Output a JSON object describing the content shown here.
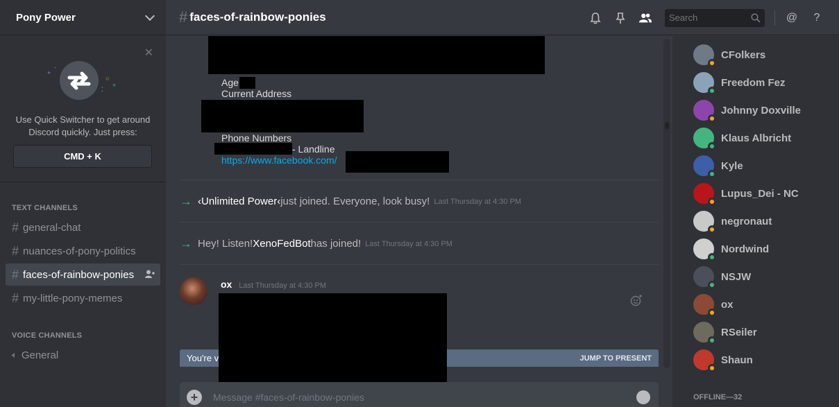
{
  "guild": {
    "name": "Pony Power"
  },
  "quick_switcher": {
    "text": "Use Quick Switcher to get around Discord quickly. Just press:",
    "shortcut": "CMD + K",
    "close": "✕"
  },
  "sidebar": {
    "text_category": "TEXT CHANNELS",
    "voice_category": "VOICE CHANNELS",
    "text_channels": [
      {
        "label": "general-chat"
      },
      {
        "label": "nuances-of-pony-politics"
      },
      {
        "label": "faces-of-rainbow-ponies"
      },
      {
        "label": "my-little-pony-memes"
      }
    ],
    "voice_channels": [
      {
        "label": "General"
      }
    ]
  },
  "header": {
    "hash": "#",
    "channel": "faces-of-rainbow-ponies",
    "search_placeholder": "Search",
    "mention": "@",
    "help": "?"
  },
  "messages": {
    "age_label": "Age",
    "current_address_label": "Current Address",
    "phone_numbers_label": "Phone Numbers",
    "landline_label": "- Landline",
    "facebook_url": "https://www.facebook.com/",
    "system1": {
      "user": "‹Unlimited Power‹",
      "text": " just joined. Everyone, look busy!",
      "time": "Last Thursday at 4:30 PM"
    },
    "system2": {
      "pre": "Hey! Listen! ",
      "user": "XenoFedBot",
      "text": " has joined!",
      "time": "Last Thursday at 4:30 PM"
    },
    "post": {
      "author": "ox",
      "time": "Last Thursday at 4:30 PM"
    }
  },
  "jump_bar": {
    "left": "You're v",
    "right": "JUMP TO PRESENT"
  },
  "composer": {
    "placeholder": "Message #faces-of-rainbow-ponies"
  },
  "members": {
    "online": [
      {
        "name": "CFolkers",
        "status": "#faa61a",
        "color": "#6f7a88"
      },
      {
        "name": "Freedom Fez",
        "status": "#43b581",
        "color": "#8aa3b8"
      },
      {
        "name": "Johnny Doxville",
        "status": "#faa61a",
        "color": "#8e44ad"
      },
      {
        "name": "Klaus Albricht",
        "status": "#43b581",
        "color": "#43b581"
      },
      {
        "name": "Kyle",
        "status": "#43b581",
        "color": "#3b5fa8"
      },
      {
        "name": "Lupus_Dei - NC",
        "status": "#faa61a",
        "color": "#b8161b"
      },
      {
        "name": "negronaut",
        "status": "#faa61a",
        "color": "#c9c9c9"
      },
      {
        "name": "Nordwind",
        "status": "#43b581",
        "color": "#d0d0d0"
      },
      {
        "name": "NSJW",
        "status": "#43b581",
        "color": "#4a4f5a"
      },
      {
        "name": "ox",
        "status": "#faa61a",
        "color": "#8c4a36"
      },
      {
        "name": "RSeiler",
        "status": "#43b581",
        "color": "#6e6a5c"
      },
      {
        "name": "Shaun",
        "status": "#faa61a",
        "color": "#c0392b"
      }
    ],
    "offline_label": "OFFLINE—32"
  }
}
